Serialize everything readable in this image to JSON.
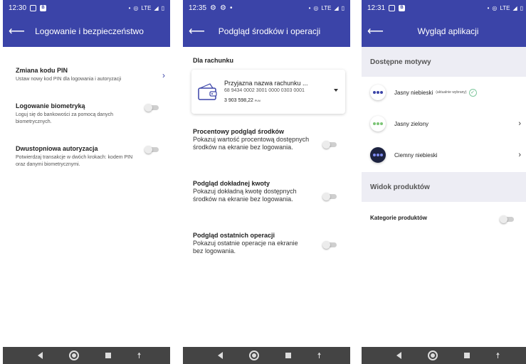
{
  "colors": {
    "primary": "#3b44a8",
    "check": "#5bb37e"
  },
  "panel1": {
    "status_time": "12:30",
    "title": "Logowanie i bezpieczeństwo",
    "items": [
      {
        "title": "Zmiana kodu PIN",
        "desc": "Ustaw nowy kod PIN dla logowania i autoryzacji"
      },
      {
        "title": "Logowanie biometryką",
        "desc": "Loguj się do bankowości za pomocą danych biometrycznych."
      },
      {
        "title": "Dwustopniowa autoryzacja",
        "desc": "Potwierdzaj transakcje w dwóch krokach: kodem PIN oraz danymi biometrycznymi."
      }
    ]
  },
  "panel2": {
    "status_time": "12:35",
    "title": "Podgląd środków i operacji",
    "section_label": "Dla rachunku",
    "account": {
      "name": "Przyjazna nazwa rachunku ...",
      "number": "68 9434 0002 3001 0000 0303 0001",
      "balance": "3 903 598,22",
      "currency": "PLN"
    },
    "items": [
      {
        "title": "Procentowy podgląd środków",
        "desc": "Pokazuj wartość procentową dostępnych środków na ekranie bez logowania."
      },
      {
        "title": "Podgląd dokładnej kwoty",
        "desc": "Pokazuj dokładną kwotę dostępnych środków na ekranie bez logowania."
      },
      {
        "title": "Podgląd ostatnich operacji",
        "desc": "Pokazuj ostatnie operacje na ekranie bez logowania."
      }
    ]
  },
  "panel3": {
    "status_time": "12:31",
    "title": "Wygląd aplikacji",
    "themes_header": "Dostępne motywy",
    "themes": [
      {
        "label": "Jasny niebieski",
        "note": "(aktualnie wybrany)"
      },
      {
        "label": "Jasny zielony"
      },
      {
        "label": "Ciemny niebieski"
      }
    ],
    "products_header": "Widok produktów",
    "categories_label": "Kategorie produktów"
  },
  "status": {
    "network": "LTE"
  }
}
